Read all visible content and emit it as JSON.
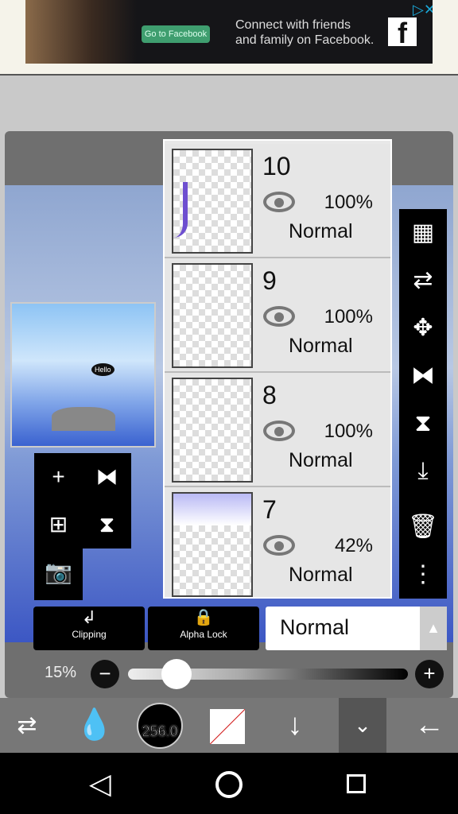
{
  "ad": {
    "button": "Go to Facebook",
    "text_line1": "Connect with friends",
    "text_line2": "and family on Facebook.",
    "logo": "f",
    "close": "▷✕"
  },
  "layers": [
    {
      "number": "10",
      "opacity": "100%",
      "mode": "Normal"
    },
    {
      "number": "9",
      "opacity": "100%",
      "mode": "Normal"
    },
    {
      "number": "8",
      "opacity": "100%",
      "mode": "Normal"
    },
    {
      "number": "7",
      "opacity": "42%",
      "mode": "Normal"
    }
  ],
  "canvas_text": "Hello",
  "toolbar": {
    "clipping": "Clipping",
    "alpha_lock": "Alpha Lock",
    "blend_mode": "Normal"
  },
  "opacity": {
    "label": "15%",
    "value": 15
  },
  "bottom": {
    "brush_size": "256.0"
  },
  "colors": {
    "accent": "#000000",
    "panel": "#6f6f6f"
  }
}
